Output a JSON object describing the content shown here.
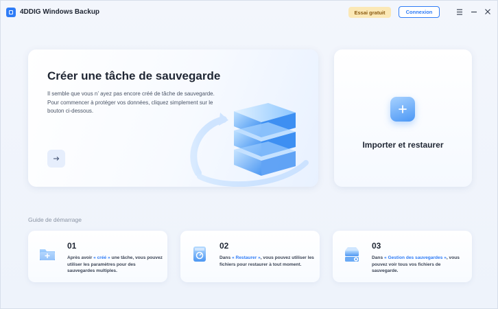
{
  "app": {
    "title": "4DDIG Windows Backup",
    "trial_label": "Essai gratuit",
    "login_label": "Connexion"
  },
  "create": {
    "title": "Créer une tâche de sauvegarde",
    "description": "Il semble que vous n’ ayez pas encore créé de tâche de sauvegarde. Pour commencer à protéger vos données, cliquez simplement sur le bouton ci-dessous."
  },
  "import": {
    "label": "Importer et restaurer"
  },
  "guide": {
    "heading": "Guide de démarrage",
    "steps": [
      {
        "number": "01",
        "before": "Après avoir ",
        "highlight": "« créé »",
        "after": " une tâche, vous pouvez utiliser les paramètres pour des sauvegardes multiples."
      },
      {
        "number": "02",
        "before": "Dans ",
        "highlight": "« Restaurer »",
        "after": ", vous pouvez utiliser les fichiers pour restaurer à tout moment."
      },
      {
        "number": "03",
        "before": "Dans ",
        "highlight": "« Gestion des sauvegardes »",
        "after": ", vous pouvez voir tous vos fichiers de sauvegarde."
      }
    ]
  },
  "colors": {
    "accent": "#2f7cf6",
    "trial_bg": "#fbe8b6",
    "trial_text": "#8a5a12",
    "background": "#eef3fb"
  },
  "icons": {
    "app_logo": "app-logo-icon",
    "menu": "menu-icon",
    "minimize": "minimize-icon",
    "close": "close-icon",
    "arrow": "arrow-right-icon",
    "plus": "plus-icon",
    "step1": "folder-icon",
    "step2": "restore-drive-icon",
    "step3": "backup-manage-icon"
  }
}
